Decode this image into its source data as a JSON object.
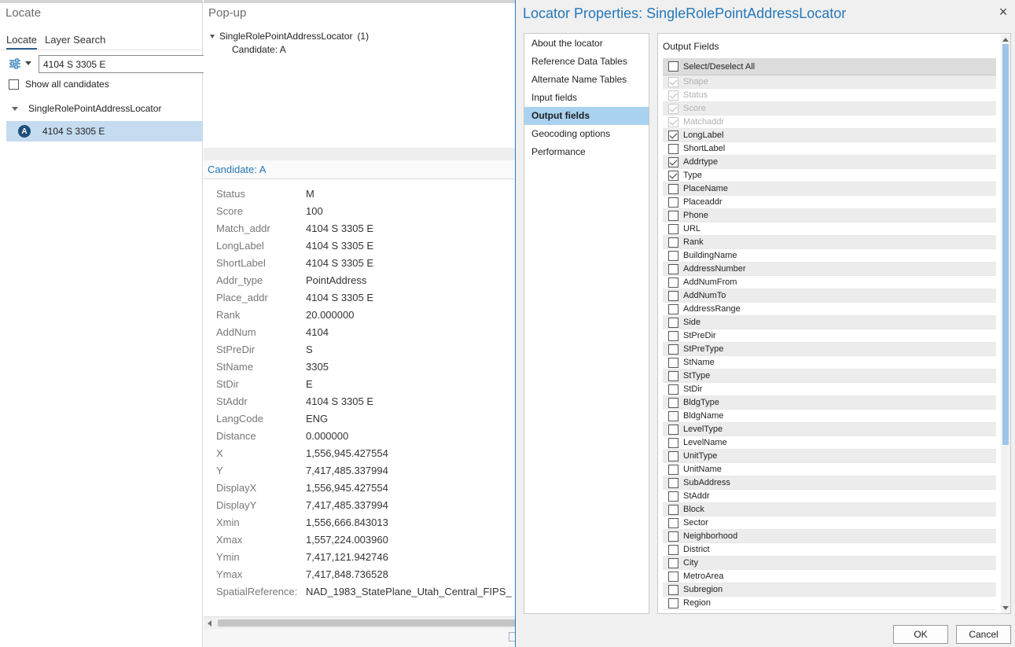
{
  "locate": {
    "title": "Locate",
    "tabs": [
      "Locate",
      "Layer Search"
    ],
    "search_value": "4104 S 3305 E",
    "show_all_label": "Show all candidates",
    "locator_name": "SingleRolePointAddressLocator",
    "candidate_badge": "A",
    "candidate_label": "4104 S 3305 E"
  },
  "popup": {
    "title": "Pop-up",
    "tree_label": "SingleRolePointAddressLocator",
    "tree_count": "(1)",
    "child_label": "Candidate: A",
    "candidate_header": "Candidate: A",
    "attributes": [
      {
        "name": "Status",
        "value": "M"
      },
      {
        "name": "Score",
        "value": "100"
      },
      {
        "name": "Match_addr",
        "value": "4104 S 3305 E"
      },
      {
        "name": "LongLabel",
        "value": "4104 S 3305 E"
      },
      {
        "name": "ShortLabel",
        "value": "4104 S 3305 E"
      },
      {
        "name": "Addr_type",
        "value": "PointAddress"
      },
      {
        "name": "Place_addr",
        "value": "4104 S 3305 E"
      },
      {
        "name": "Rank",
        "value": "20.000000"
      },
      {
        "name": "AddNum",
        "value": "4104"
      },
      {
        "name": "StPreDir",
        "value": "S"
      },
      {
        "name": "StName",
        "value": "3305"
      },
      {
        "name": "StDir",
        "value": "E"
      },
      {
        "name": "StAddr",
        "value": "4104 S 3305 E"
      },
      {
        "name": "LangCode",
        "value": "ENG"
      },
      {
        "name": "Distance",
        "value": "0.000000"
      },
      {
        "name": "X",
        "value": "1,556,945.427554"
      },
      {
        "name": "Y",
        "value": "7,417,485.337994"
      },
      {
        "name": "DisplayX",
        "value": "1,556,945.427554"
      },
      {
        "name": "DisplayY",
        "value": "7,417,485.337994"
      },
      {
        "name": "Xmin",
        "value": "1,556,666.843013"
      },
      {
        "name": "Xmax",
        "value": "1,557,224.003960"
      },
      {
        "name": "Ymin",
        "value": "7,417,121.942746"
      },
      {
        "name": "Ymax",
        "value": "7,417,848.736528"
      },
      {
        "name": "SpatialReference:",
        "value": "NAD_1983_StatePlane_Utah_Central_FIPS_"
      }
    ]
  },
  "dialog": {
    "title": "Locator Properties: SingleRolePointAddressLocator",
    "close_glyph": "×",
    "nav": [
      {
        "label": "About the locator",
        "active": false
      },
      {
        "label": "Reference Data Tables",
        "active": false
      },
      {
        "label": "Alternate Name Tables",
        "active": false
      },
      {
        "label": "Input fields",
        "active": false
      },
      {
        "label": "Output fields",
        "active": true
      },
      {
        "label": "Geocoding options",
        "active": false
      },
      {
        "label": "Performance",
        "active": false
      }
    ],
    "fields_heading": "Output Fields",
    "select_all_label": "Select/Deselect All",
    "fields": [
      {
        "label": "Shape",
        "checked": true,
        "disabled": true
      },
      {
        "label": "Status",
        "checked": true,
        "disabled": true
      },
      {
        "label": "Score",
        "checked": true,
        "disabled": true
      },
      {
        "label": "Matchaddr",
        "checked": true,
        "disabled": true
      },
      {
        "label": "LongLabel",
        "checked": true,
        "disabled": false
      },
      {
        "label": "ShortLabel",
        "checked": false,
        "disabled": false
      },
      {
        "label": "Addrtype",
        "checked": true,
        "disabled": false
      },
      {
        "label": "Type",
        "checked": true,
        "disabled": false
      },
      {
        "label": "PlaceName",
        "checked": false,
        "disabled": false
      },
      {
        "label": "Placeaddr",
        "checked": false,
        "disabled": false
      },
      {
        "label": "Phone",
        "checked": false,
        "disabled": false
      },
      {
        "label": "URL",
        "checked": false,
        "disabled": false
      },
      {
        "label": "Rank",
        "checked": false,
        "disabled": false
      },
      {
        "label": "BuildingName",
        "checked": false,
        "disabled": false
      },
      {
        "label": "AddressNumber",
        "checked": false,
        "disabled": false
      },
      {
        "label": "AddNumFrom",
        "checked": false,
        "disabled": false
      },
      {
        "label": "AddNumTo",
        "checked": false,
        "disabled": false
      },
      {
        "label": "AddressRange",
        "checked": false,
        "disabled": false
      },
      {
        "label": "Side",
        "checked": false,
        "disabled": false
      },
      {
        "label": "StPreDir",
        "checked": false,
        "disabled": false
      },
      {
        "label": "StPreType",
        "checked": false,
        "disabled": false
      },
      {
        "label": "StName",
        "checked": false,
        "disabled": false
      },
      {
        "label": "StType",
        "checked": false,
        "disabled": false
      },
      {
        "label": "StDir",
        "checked": false,
        "disabled": false
      },
      {
        "label": "BldgType",
        "checked": false,
        "disabled": false
      },
      {
        "label": "BldgName",
        "checked": false,
        "disabled": false
      },
      {
        "label": "LevelType",
        "checked": false,
        "disabled": false
      },
      {
        "label": "LevelName",
        "checked": false,
        "disabled": false
      },
      {
        "label": "UnitType",
        "checked": false,
        "disabled": false
      },
      {
        "label": "UnitName",
        "checked": false,
        "disabled": false
      },
      {
        "label": "SubAddress",
        "checked": false,
        "disabled": false
      },
      {
        "label": "StAddr",
        "checked": false,
        "disabled": false
      },
      {
        "label": "Block",
        "checked": false,
        "disabled": false
      },
      {
        "label": "Sector",
        "checked": false,
        "disabled": false
      },
      {
        "label": "Neighborhood",
        "checked": false,
        "disabled": false
      },
      {
        "label": "District",
        "checked": false,
        "disabled": false
      },
      {
        "label": "City",
        "checked": false,
        "disabled": false
      },
      {
        "label": "MetroArea",
        "checked": false,
        "disabled": false
      },
      {
        "label": "Subregion",
        "checked": false,
        "disabled": false
      },
      {
        "label": "Region",
        "checked": false,
        "disabled": false
      }
    ],
    "ok_label": "OK",
    "cancel_label": "Cancel"
  },
  "icons": {
    "options": "sliders-icon",
    "close": "close-icon",
    "tree_caret": "chevron-down-icon"
  }
}
